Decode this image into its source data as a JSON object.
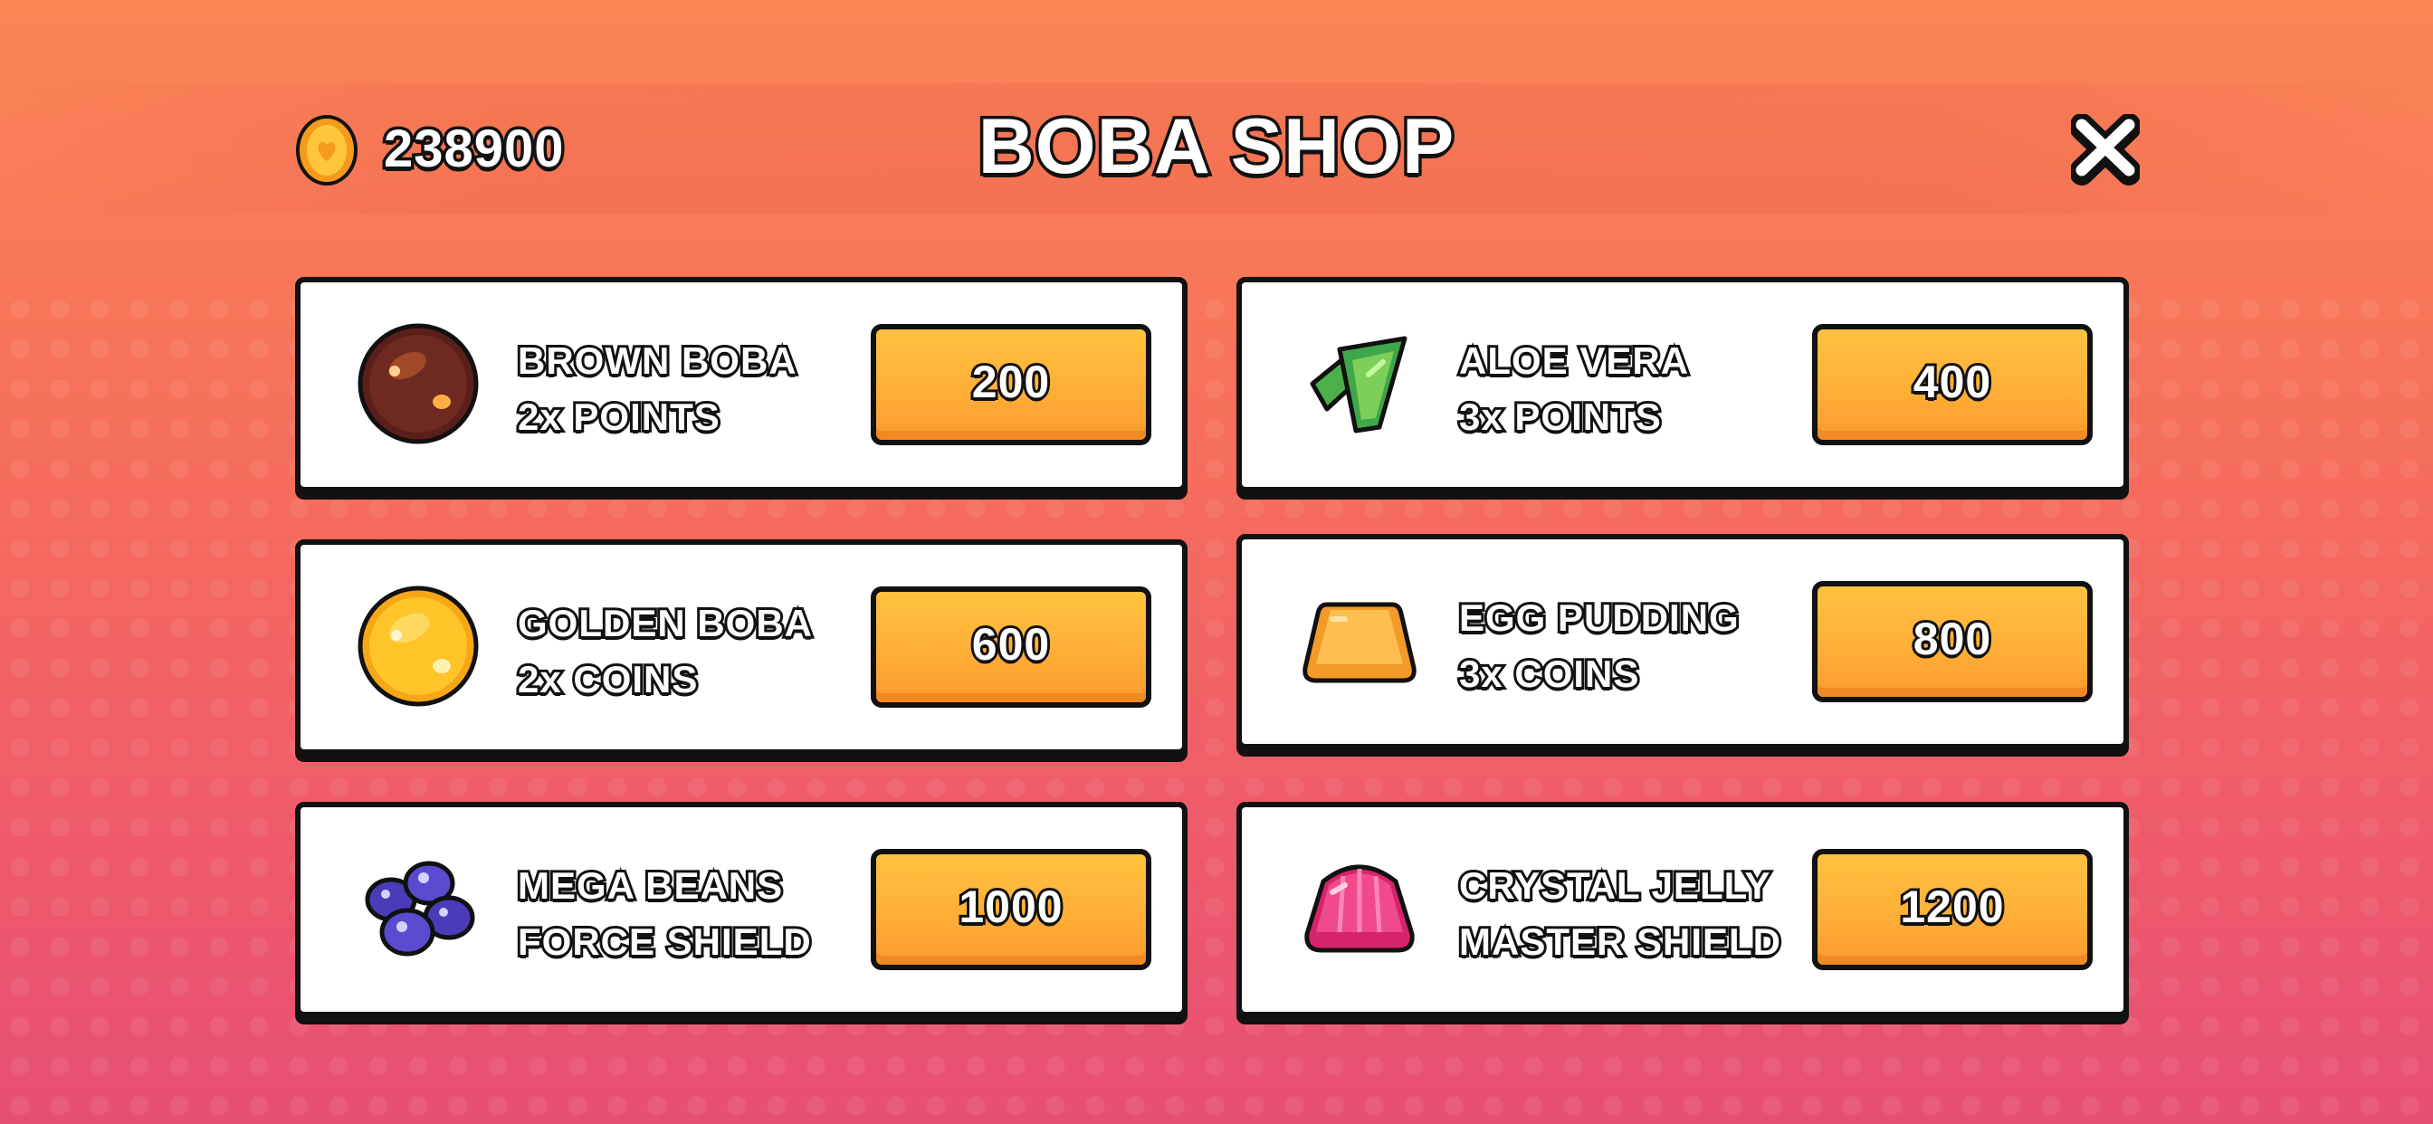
{
  "header": {
    "coins": "238900",
    "title": "BOBA SHOP",
    "coin_icon": "coin-icon",
    "close_icon": "close-icon"
  },
  "items": [
    {
      "name": "BROWN BOBA",
      "effect": "2x POINTS",
      "price": "200",
      "icon": "brown-boba-icon"
    },
    {
      "name": "ALOE VERA",
      "effect": "3x POINTS",
      "price": "400",
      "icon": "aloe-vera-icon"
    },
    {
      "name": "GOLDEN BOBA",
      "effect": "2x COINS",
      "price": "600",
      "icon": "golden-boba-icon"
    },
    {
      "name": "EGG PUDDING",
      "effect": "3x COINS",
      "price": "800",
      "icon": "egg-pudding-icon"
    },
    {
      "name": "MEGA BEANS",
      "effect": "FORCE SHIELD",
      "price": "1000",
      "icon": "mega-beans-icon"
    },
    {
      "name": "CRYSTAL JELLY",
      "effect": "MASTER SHIELD",
      "price": "1200",
      "icon": "crystal-jelly-icon"
    }
  ],
  "colors": {
    "background_top": "#fb8656",
    "background_bottom": "#e64f74",
    "button": "#ffb13a",
    "outline": "#111111"
  }
}
